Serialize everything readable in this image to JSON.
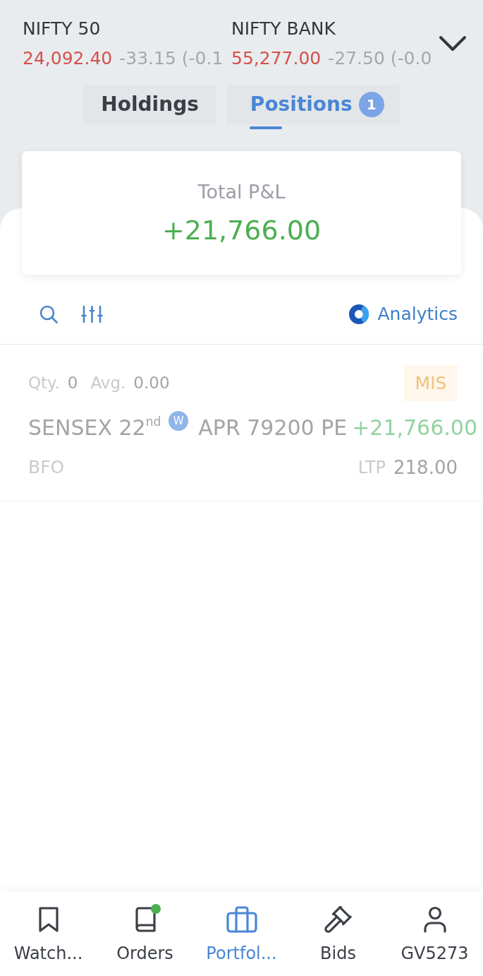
{
  "indices": [
    {
      "name": "NIFTY 50",
      "value": "24,092.40",
      "change": "-33.15 (-0.1",
      "negative": true
    },
    {
      "name": "NIFTY BANK",
      "value": "55,277.00",
      "change": "-27.50 (-0.0",
      "negative": true
    }
  ],
  "tabs": [
    {
      "label": "Holdings",
      "selected": false
    },
    {
      "label": "Positions",
      "selected": true,
      "badge": "1"
    }
  ],
  "total_pnl": {
    "label": "Total P&L",
    "value": "+21,766.00"
  },
  "toolbar": {
    "analytics": "Analytics"
  },
  "positions": [
    {
      "qty_label": "Qty.",
      "qty": "0",
      "avg_label": "Avg.",
      "avg": "0.00",
      "product": "MIS",
      "symbol": "SENSEX 22$^{nd}$",
      "tag": "W",
      "contract": "APR 79200 PE",
      "pnl": "+21,766.00",
      "exchange": "BFO",
      "ltp_label": "LTP",
      "ltp": "218.00"
    }
  ],
  "bottom_nav": [
    {
      "label": "Watch...",
      "kind": "bookmark",
      "selected": false,
      "notification": false
    },
    {
      "label": "Orders",
      "kind": "book",
      "selected": false,
      "notification": true
    },
    {
      "label": "Portfol...",
      "kind": "briefcase",
      "selected": true,
      "notification": false
    },
    {
      "label": "Bids",
      "kind": "gavel",
      "selected": false,
      "notification": false
    },
    {
      "label": "GV5273",
      "kind": "user",
      "selected": false,
      "notification": false
    }
  ]
}
